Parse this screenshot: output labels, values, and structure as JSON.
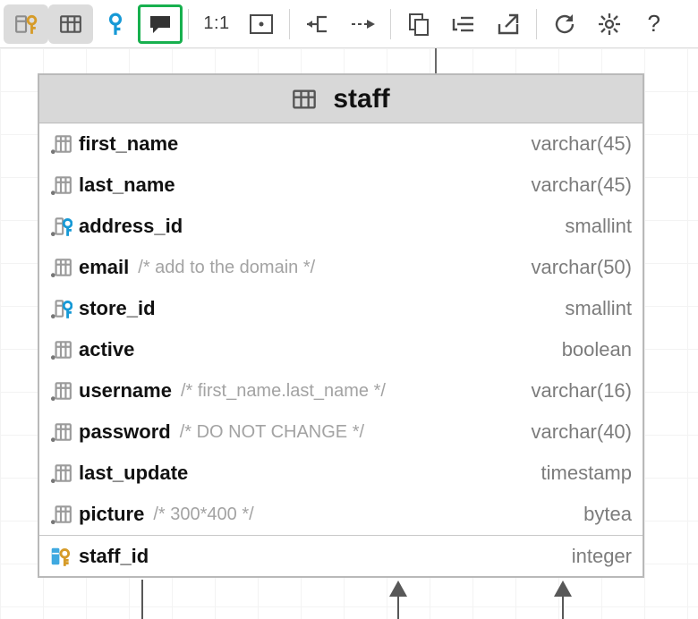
{
  "toolbar": {
    "zoom_label": "1:1"
  },
  "table": {
    "name": "staff",
    "columns": [
      {
        "name": "first_name",
        "type": "varchar(45)",
        "comment": "",
        "icon": "col"
      },
      {
        "name": "last_name",
        "type": "varchar(45)",
        "comment": "",
        "icon": "col"
      },
      {
        "name": "address_id",
        "type": "smallint",
        "comment": "",
        "icon": "fk"
      },
      {
        "name": "email",
        "type": "varchar(50)",
        "comment": "/* add to the domain */",
        "icon": "col"
      },
      {
        "name": "store_id",
        "type": "smallint",
        "comment": "",
        "icon": "fk"
      },
      {
        "name": "active",
        "type": "boolean",
        "comment": "",
        "icon": "col"
      },
      {
        "name": "username",
        "type": "varchar(16)",
        "comment": "/* first_name.last_name */",
        "icon": "col"
      },
      {
        "name": "password",
        "type": "varchar(40)",
        "comment": "/* DO NOT CHANGE */",
        "icon": "col"
      },
      {
        "name": "last_update",
        "type": "timestamp",
        "comment": "",
        "icon": "col"
      },
      {
        "name": "picture",
        "type": "bytea",
        "comment": "/* 300*400 */",
        "icon": "col"
      }
    ],
    "primary_key": {
      "name": "staff_id",
      "type": "integer",
      "comment": "",
      "icon": "pk"
    }
  }
}
